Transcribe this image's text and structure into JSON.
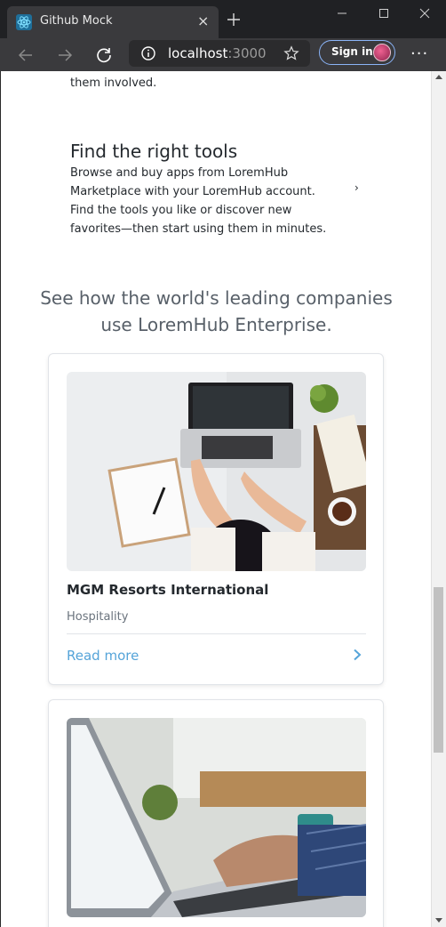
{
  "browser": {
    "tab_title": "Github Mock",
    "tab_close": "×",
    "url_host": "localhost",
    "url_port": ":3000",
    "signin_label": "Sign in",
    "menu": "···"
  },
  "content": {
    "involved_text": "them involved.",
    "tools_title": "Find the right tools",
    "tools_description": "Browse and buy apps from LoremHub Marketplace with your LoremHub account. Find the tools you like or discover new favorites—then start using them in minutes.",
    "tools_chevron": "›",
    "section_heading": "See how the world's leading companies use LoremHub Enterprise."
  },
  "cards": [
    {
      "title": "MGM Resorts International",
      "category": "Hospitality",
      "link_label": "Read more"
    },
    {
      "title": "",
      "category": "",
      "link_label": ""
    }
  ],
  "colors": {
    "link": "#55a4d9",
    "chrome_dark": "#202124",
    "toolbar": "#3a3a3d"
  }
}
